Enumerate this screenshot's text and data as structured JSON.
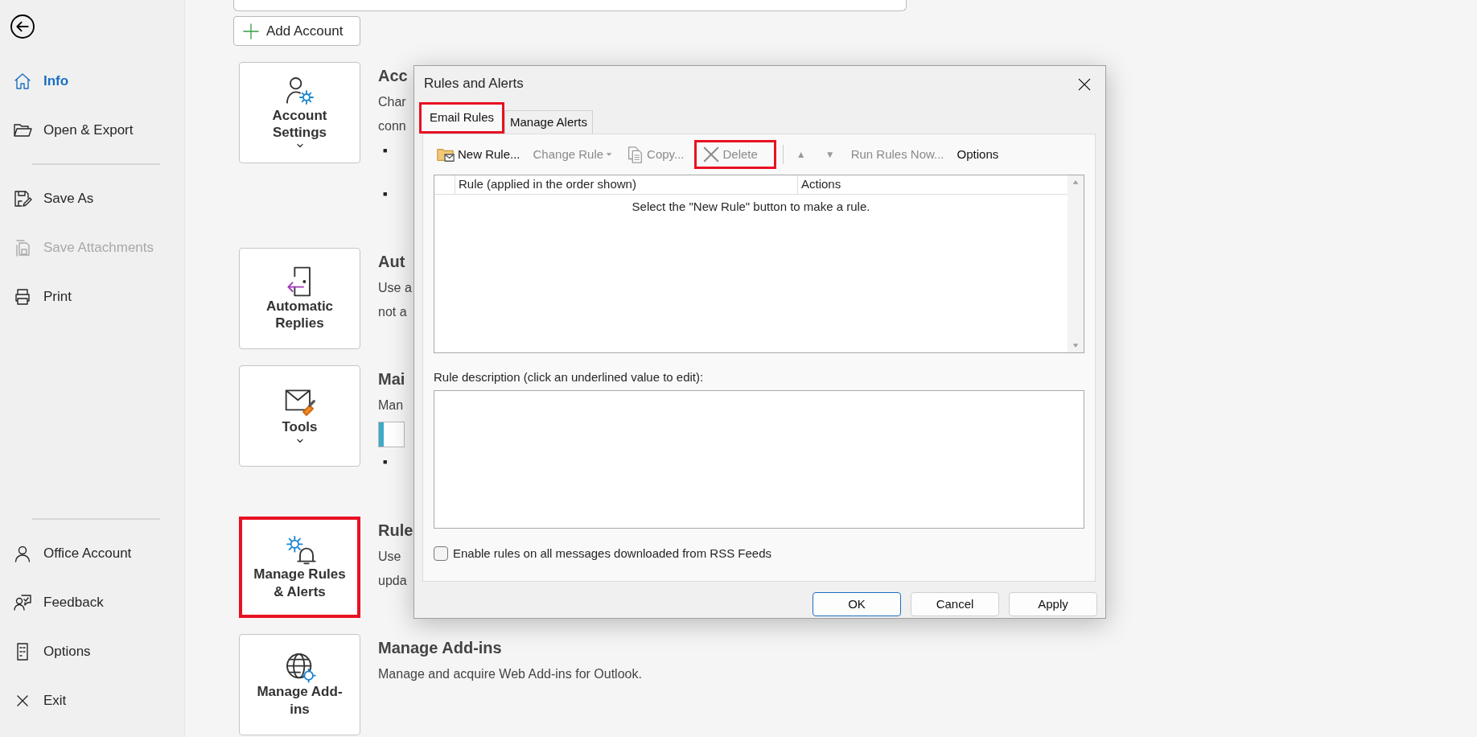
{
  "sidebar": {
    "top_items": [
      {
        "label": "Info",
        "selected": true,
        "disabled": false
      },
      {
        "label": "Open & Export",
        "selected": false,
        "disabled": false
      },
      {
        "label": "Save As",
        "selected": false,
        "disabled": false
      },
      {
        "label": "Save Attachments",
        "selected": false,
        "disabled": true
      },
      {
        "label": "Print",
        "selected": false,
        "disabled": false
      }
    ],
    "bottom_items": [
      {
        "label": "Office Account",
        "selected": false,
        "disabled": false
      },
      {
        "label": "Feedback",
        "selected": false,
        "disabled": false
      },
      {
        "label": "Options",
        "selected": false,
        "disabled": false
      },
      {
        "label": "Exit",
        "selected": false,
        "disabled": false
      }
    ]
  },
  "main": {
    "add_account_button": "Add Account",
    "sections": [
      {
        "card_label": "Account Settings",
        "dropdown": true,
        "highlighted": false,
        "heading": "Acc",
        "items": [
          {
            "kind": "line",
            "text": "Char"
          },
          {
            "kind": "line",
            "text": "conn"
          },
          {
            "kind": "bullet",
            "text": "■"
          },
          {
            "kind": "bullet",
            "text": "■"
          }
        ]
      },
      {
        "card_label": "Automatic Replies",
        "dropdown": false,
        "highlighted": false,
        "heading": "Aut",
        "items": [
          {
            "kind": "line",
            "text": "Use a"
          },
          {
            "kind": "line",
            "text": "not a"
          }
        ]
      },
      {
        "card_label": "Tools",
        "dropdown": true,
        "highlighted": false,
        "heading": "Mai",
        "items": [
          {
            "kind": "line",
            "text": "Man"
          },
          {
            "kind": "meter",
            "level": 0.2
          },
          {
            "kind": "bullet",
            "text": "■"
          }
        ]
      },
      {
        "card_label": "Manage Rules & Alerts",
        "dropdown": false,
        "highlighted": true,
        "heading": "Rule",
        "items": [
          {
            "kind": "line",
            "text": "Use"
          },
          {
            "kind": "line",
            "text": "upda"
          }
        ]
      },
      {
        "card_label": "Manage Add-ins",
        "dropdown": false,
        "highlighted": false,
        "heading": "Manage Add-ins",
        "items": [
          {
            "kind": "line",
            "text": "Manage and acquire Web Add-ins for Outlook."
          }
        ]
      }
    ]
  },
  "dialog": {
    "title": "Rules and Alerts",
    "tabs": [
      {
        "label": "Email Rules",
        "selected": true,
        "highlighted": true
      },
      {
        "label": "Manage Alerts",
        "selected": false,
        "highlighted": false
      }
    ],
    "toolbar": [
      {
        "kind": "icon-button",
        "label": "New Rule...",
        "disabled": false,
        "highlighted": false
      },
      {
        "kind": "menu-button",
        "label": "Change Rule",
        "disabled": true,
        "highlighted": false
      },
      {
        "kind": "icon-button",
        "label": "Copy...",
        "disabled": true,
        "highlighted": false
      },
      {
        "kind": "icon-button",
        "label": "Delete",
        "disabled": true,
        "highlighted": true
      },
      {
        "kind": "separator"
      },
      {
        "kind": "arrow-button",
        "label": "▲",
        "disabled": true,
        "highlighted": false
      },
      {
        "kind": "arrow-button",
        "label": "▼",
        "disabled": true,
        "highlighted": false
      },
      {
        "kind": "text-button",
        "label": "Run Rules Now...",
        "disabled": true,
        "highlighted": false
      },
      {
        "kind": "text-button",
        "label": "Options",
        "disabled": false,
        "highlighted": false
      }
    ],
    "columns": [
      "Rule (applied in the order shown)",
      "Actions"
    ],
    "empty_message": "Select the \"New Rule\" button to make a rule.",
    "description_label": "Rule description (click an underlined value to edit):",
    "checkbox": {
      "label": "Enable rules on all messages downloaded from RSS Feeds",
      "checked": false
    },
    "buttons": [
      {
        "label": "OK",
        "default": true
      },
      {
        "label": "Cancel",
        "default": false
      },
      {
        "label": "Apply",
        "default": false
      }
    ]
  }
}
